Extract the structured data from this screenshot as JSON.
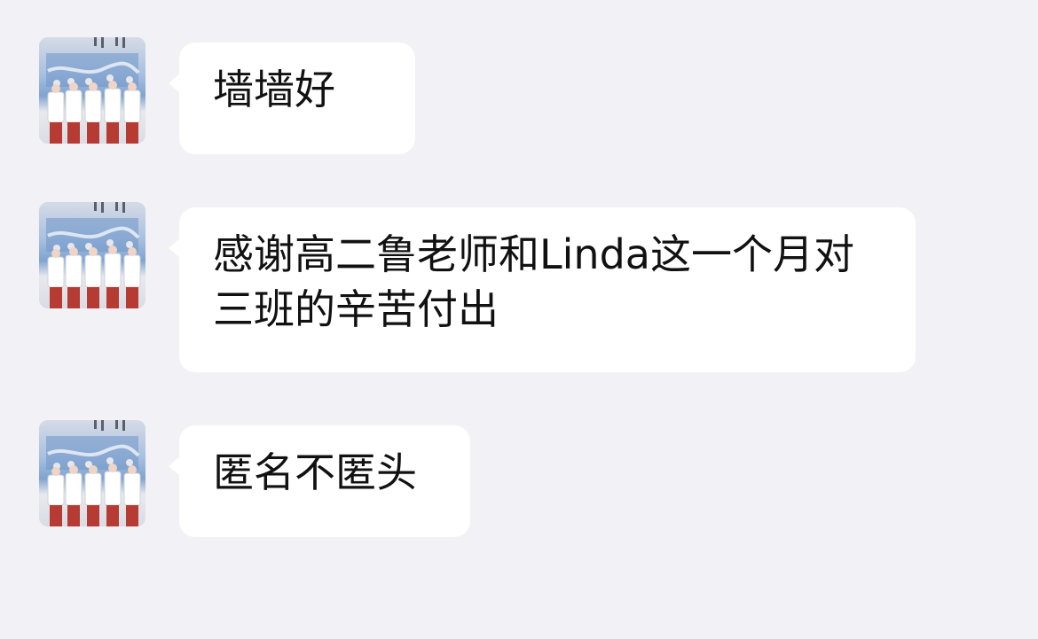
{
  "chat": {
    "messages": [
      {
        "text": "墙墙好"
      },
      {
        "text": "感谢高二鲁老师和Linda这一个月对三班的辛苦付出"
      },
      {
        "text": "匿名不匿头"
      }
    ]
  }
}
